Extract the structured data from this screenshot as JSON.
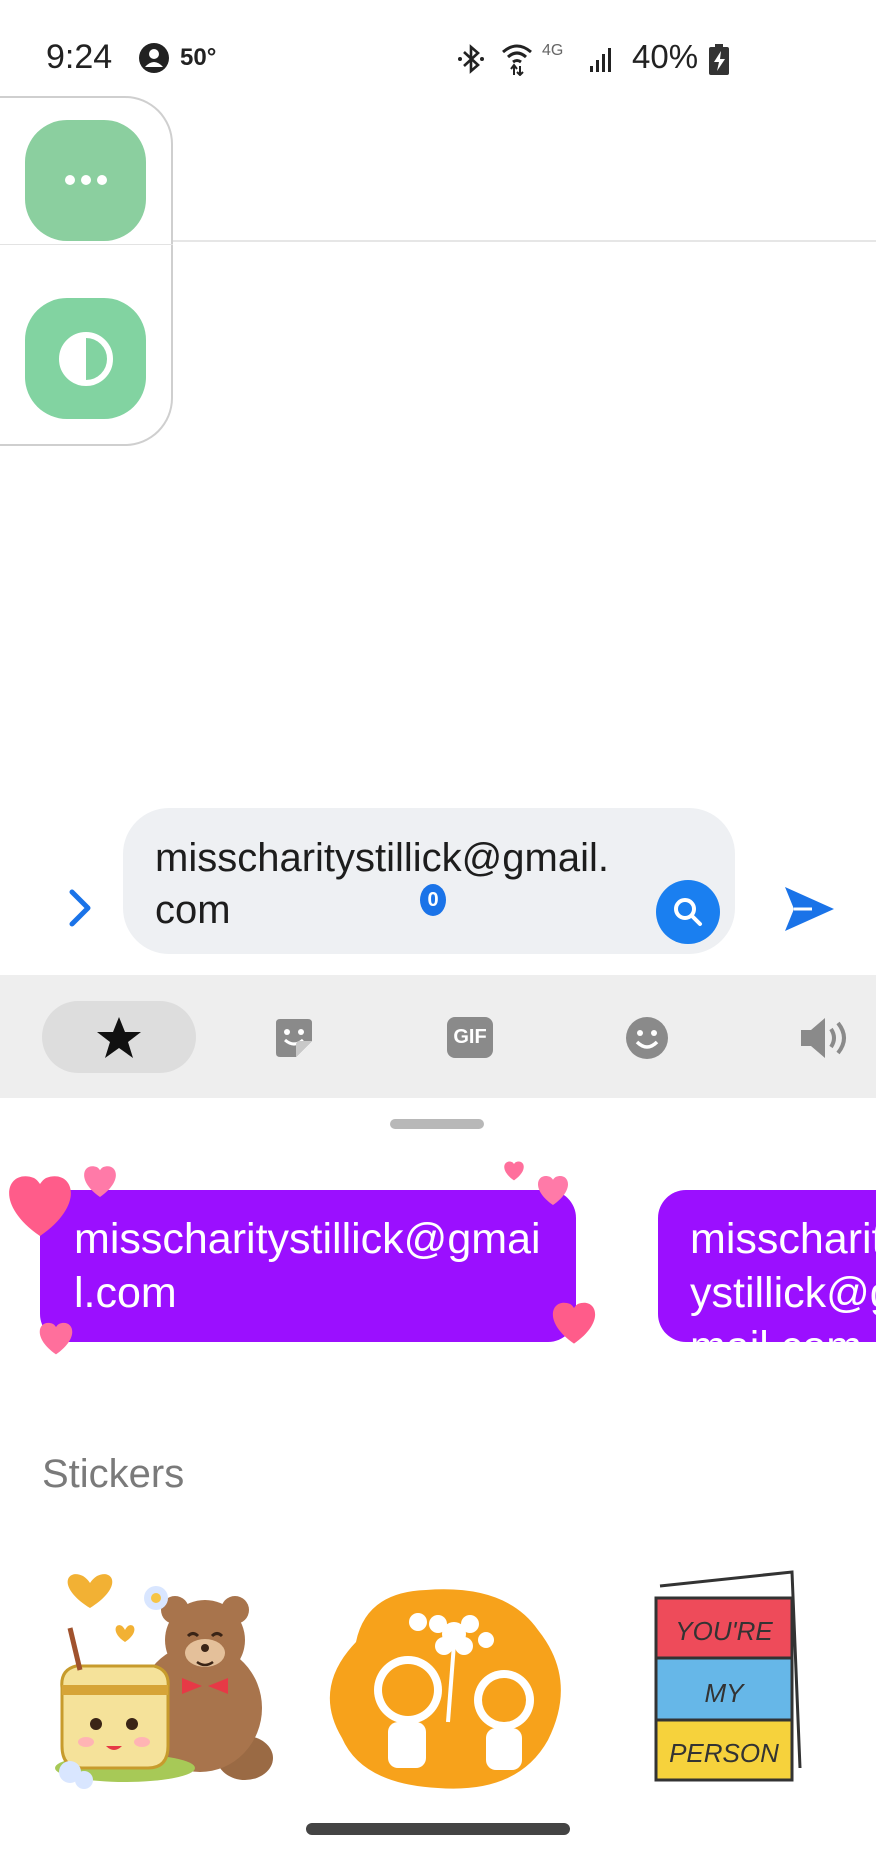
{
  "status_bar": {
    "time": "9:24",
    "temperature": "50°",
    "network": "4G",
    "battery": "40%"
  },
  "floating_panel": {
    "buttons": [
      "more-options",
      "contrast"
    ]
  },
  "composer": {
    "message_text": "misscharitystillick@gmail.com",
    "badge_count": "0"
  },
  "keyboard_toolbar": {
    "items": [
      "favorites",
      "stickers",
      "gif",
      "emoji",
      "sound"
    ],
    "gif_label": "GIF",
    "selected": "favorites"
  },
  "suggestions": {
    "bubble_1_text": "misscharitystillick@gmail.com",
    "bubble_2_text": "misscharitystillick@gmail.com",
    "bubble_color": "#9b0fff"
  },
  "stickers_section": {
    "title": "Stickers",
    "card_lines": [
      "YOU'RE",
      "MY",
      "PERSON"
    ]
  },
  "colors": {
    "accent_blue": "#1a7ff0",
    "float_green": "#82d3a1"
  }
}
